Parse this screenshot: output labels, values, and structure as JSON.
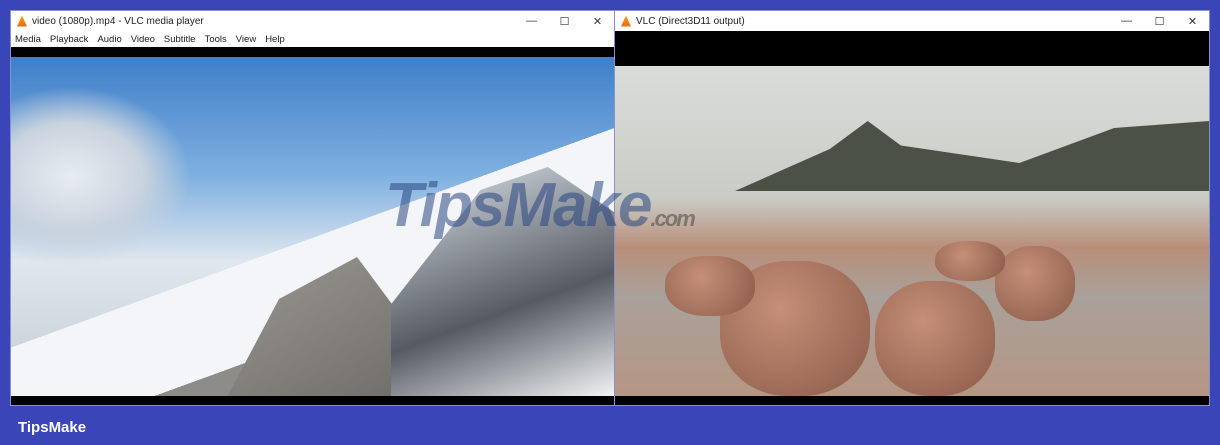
{
  "left_window": {
    "title": "video (1080p).mp4 - VLC media player",
    "menu": [
      "Media",
      "Playback",
      "Audio",
      "Video",
      "Subtitle",
      "Tools",
      "View",
      "Help"
    ]
  },
  "right_window": {
    "title": "VLC (Direct3D11 output)"
  },
  "controls": {
    "minimize": "—",
    "maximize": "☐",
    "close": "✕"
  },
  "watermark": {
    "text": "TipsMake",
    ".com": ".com"
  },
  "footer": {
    "brand": "TipsMake"
  }
}
